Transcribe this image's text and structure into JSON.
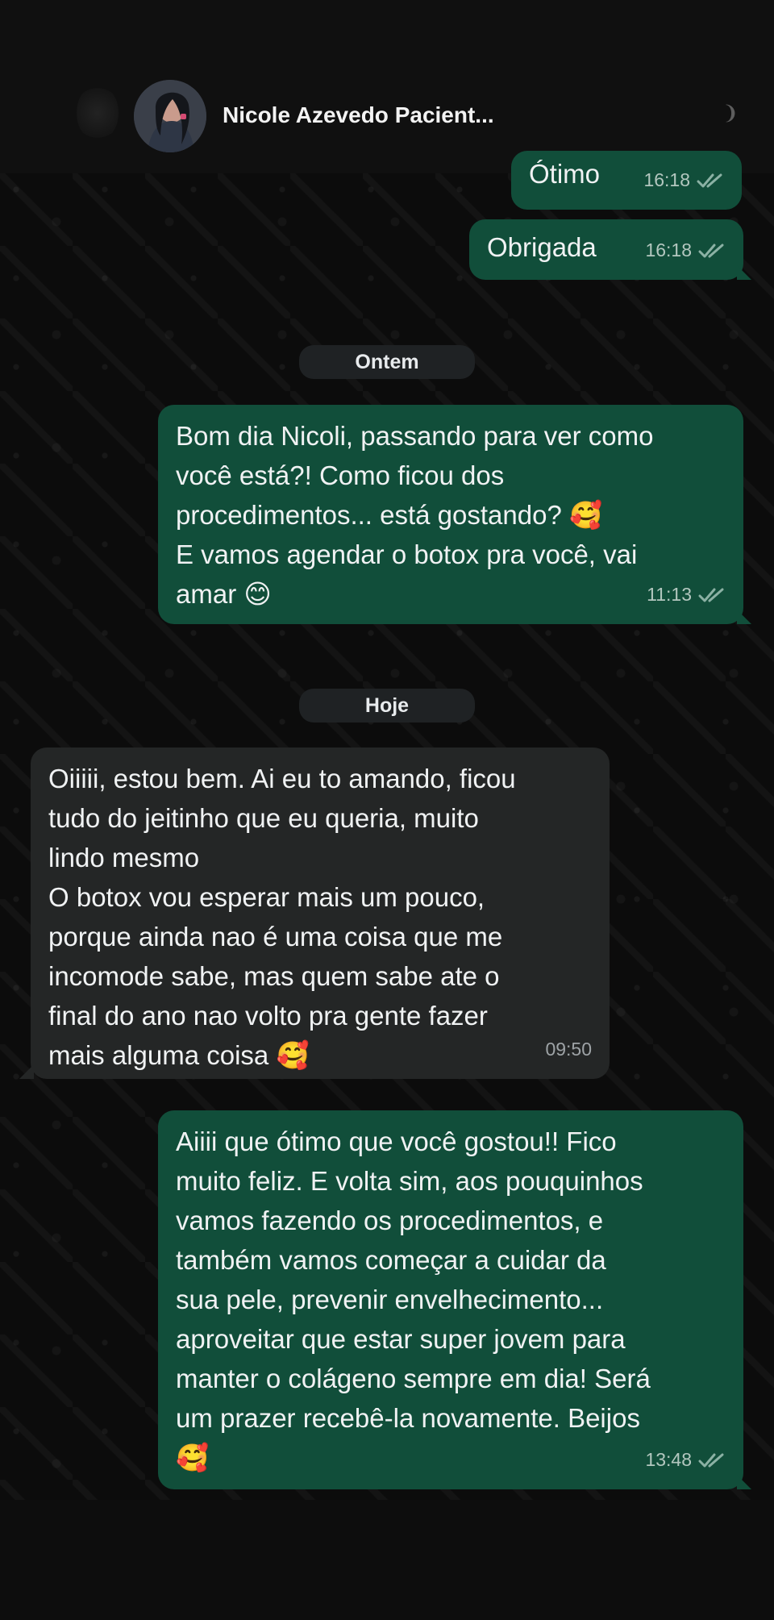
{
  "header": {
    "contact_name": "Nicole Azevedo Pacient...",
    "avatar_icon": "profile-photo-icon",
    "back_icon": "back-arrow-icon"
  },
  "chat": {
    "messages": [
      {
        "direction": "outgoing",
        "text": "Ótimo",
        "time": "16:18",
        "status_icon": "double-check-icon"
      },
      {
        "direction": "outgoing",
        "text": "Obrigada",
        "time": "16:18",
        "status_icon": "double-check-icon"
      },
      {
        "direction": "outgoing",
        "text": "Bom dia Nicoli, passando para ver como\nvocê está?! Como ficou dos\nprocedimentos... está gostando? 🥰\nE vamos agendar o botox pra você, vai\namar 😊",
        "time": "11:13",
        "status_icon": "double-check-icon"
      },
      {
        "direction": "incoming",
        "text": "Oiiiii, estou bem. Ai eu to amando, ficou\ntudo do jeitinho que eu queria, muito\nlindo mesmo\nO botox vou esperar mais um pouco,\nporque ainda nao é uma coisa que me\nincomode sabe, mas quem sabe ate o\nfinal do ano nao volto pra gente fazer\nmais alguma coisa 🥰",
        "time": "09:50"
      },
      {
        "direction": "outgoing",
        "text": "Aiiii que ótimo que você gostou!! Fico\nmuito feliz. E volta sim, aos pouquinhos\nvamos fazendo os procedimentos, e\ntambém vamos começar a cuidar da\nsua pele, prevenir envelhecimento...\naproveitar que estar super jovem para\nmanter o colágeno sempre em dia! Será\num prazer recebê-la novamente. Beijos\n🥰",
        "time": "13:48",
        "status_icon": "double-check-icon"
      }
    ],
    "day_labels": [
      "Ontem",
      "Hoje"
    ]
  },
  "colors": {
    "outgoing_bubble": "#114e3a",
    "incoming_bubble": "#242626",
    "background": "#0c0c0c"
  }
}
